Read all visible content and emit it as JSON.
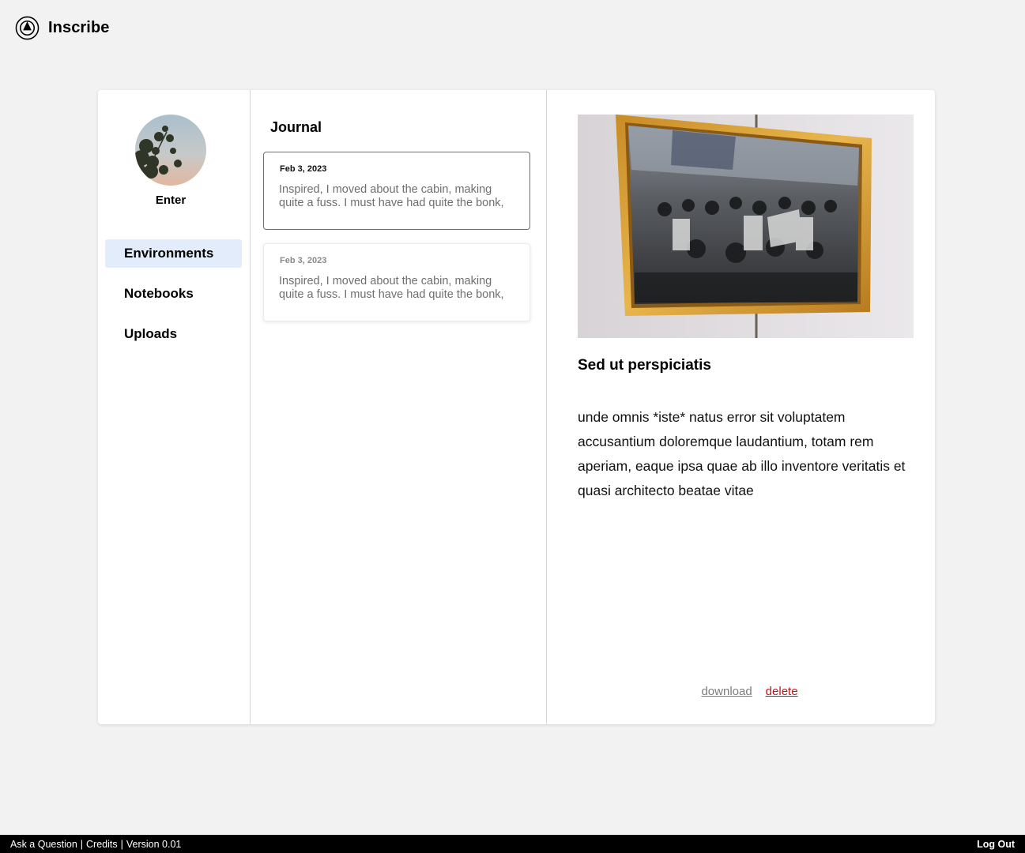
{
  "app": {
    "title": "Inscribe",
    "logo_icon": "inscribe-logo-icon"
  },
  "profile": {
    "name": "Enter",
    "avatar_icon": "avatar-image"
  },
  "nav": {
    "items": [
      {
        "label": "Environments",
        "active": true
      },
      {
        "label": "Notebooks",
        "active": false
      },
      {
        "label": "Uploads",
        "active": false
      }
    ]
  },
  "journal": {
    "title": "Journal",
    "entries": [
      {
        "date": "Feb 3, 2023",
        "preview": "Inspired, I moved about the cabin, making quite a fuss. I must have had quite the bonk,",
        "selected": true
      },
      {
        "date": "Feb 3, 2023",
        "preview": "Inspired, I moved about the cabin, making quite a fuss. I must have had quite the bonk,",
        "selected": false
      }
    ]
  },
  "detail": {
    "image": "framed-photo",
    "title": "Sed ut perspiciatis",
    "body": "unde omnis *iste* natus error sit voluptatem accusantium doloremque laudantium, totam rem aperiam, eaque ipsa quae ab illo inventore veritatis et quasi architecto beatae vitae",
    "download_label": "download",
    "delete_label": "delete"
  },
  "footer": {
    "ask": "Ask a Question",
    "credits": "Credits",
    "version": "Version 0.01",
    "separator": "|",
    "logout": "Log Out"
  },
  "colors": {
    "background": "#f2f2f2",
    "nav_active": "#e3ecfb",
    "delete": "#c2151b",
    "footer": "#000000"
  }
}
